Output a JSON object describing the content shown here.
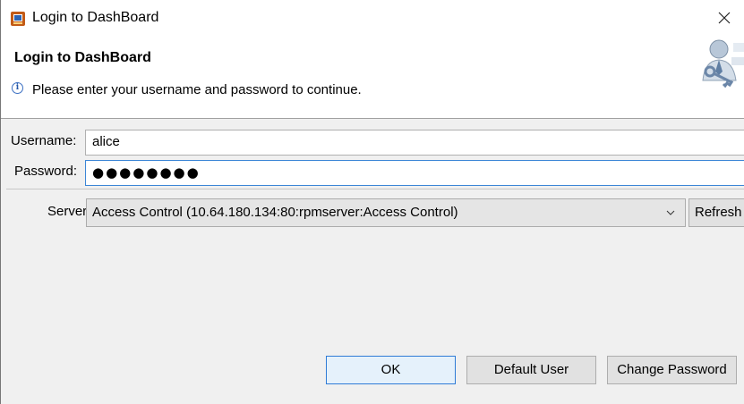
{
  "window": {
    "title": "Login to DashBoard"
  },
  "header": {
    "title": "Login to DashBoard",
    "message": "Please enter your username and password to continue."
  },
  "form": {
    "username_label": "Username:",
    "username_value": "alice",
    "password_label": "Password:",
    "password_display": "●●●●●●●●",
    "server_label": "Server:",
    "server_selected": "Access Control (10.64.180.134:80:rpmserver:Access Control)",
    "refresh_label": "Refresh"
  },
  "buttons": {
    "ok": "OK",
    "default_user": "Default User",
    "change_password": "Change Password"
  },
  "colors": {
    "focus_border": "#3c86d6",
    "default_button_border": "#2f7bd6",
    "info_icon": "#2456a8",
    "app_icon": "#c25a16"
  },
  "icons": {
    "app": "dashboard-app-icon",
    "close": "close-icon",
    "info": "info-icon",
    "header_graphic": "user-key-icon",
    "dropdown": "chevron-down-icon"
  }
}
